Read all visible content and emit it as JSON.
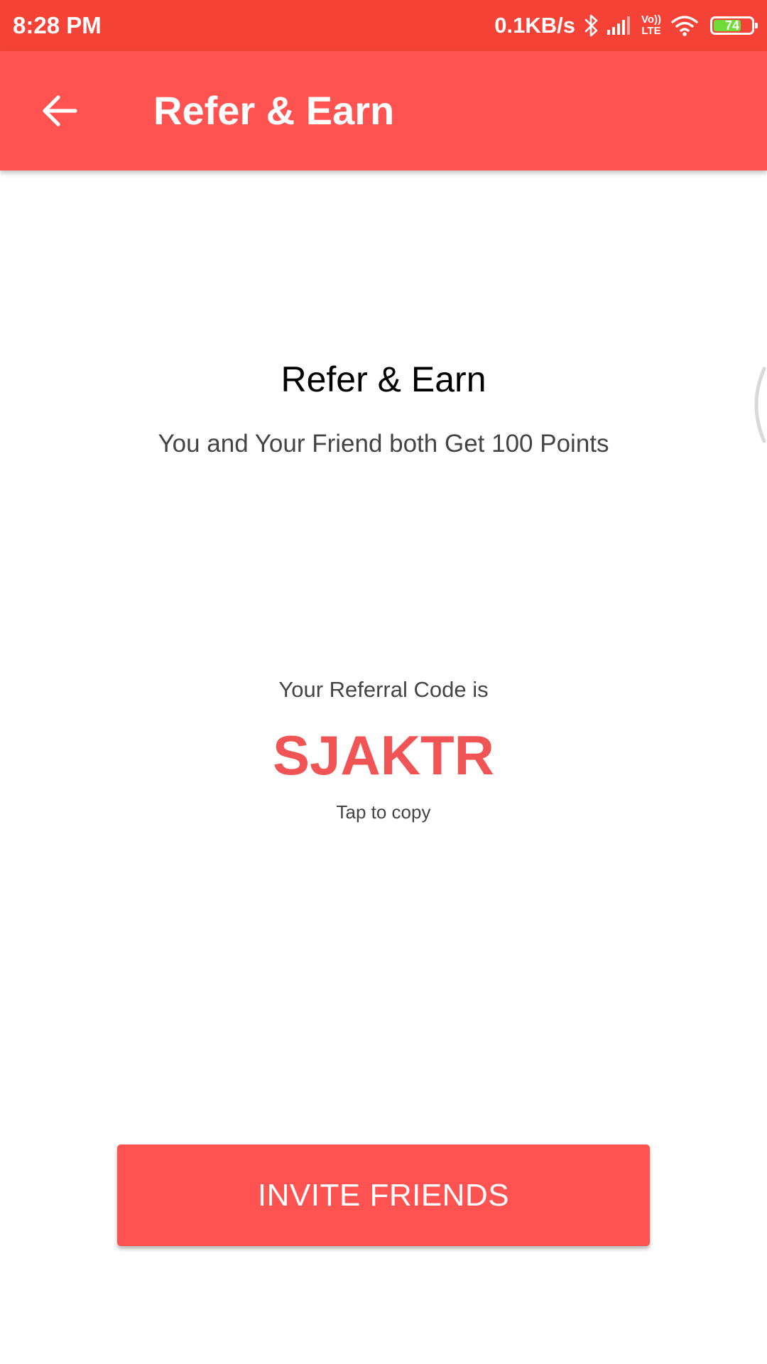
{
  "status_bar": {
    "time": "8:28 PM",
    "net_speed": "0.1KB/s",
    "volte_top": "Vo))",
    "volte_bottom": "LTE",
    "battery_level": "74",
    "battery_fill": 0.74,
    "battery_color": "#6fdc3a",
    "icons": [
      "bluetooth-icon",
      "signal-icon",
      "volte-icon",
      "wifi-icon",
      "battery-icon"
    ]
  },
  "app_bar": {
    "title": "Refer & Earn",
    "back_icon": "arrow-left-icon",
    "color": "#fe5351"
  },
  "content": {
    "title": "Refer & Earn",
    "subtitle": "You and Your Friend both Get 100 Points",
    "referral_label": "Your Referral Code is",
    "referral_code": "SJAKTR",
    "copy_hint": "Tap to copy",
    "code_color": "#f05454"
  },
  "actions": {
    "invite_label": "INVITE FRIENDS"
  },
  "colors": {
    "status_bar": "#f44336",
    "accent": "#fe5351"
  }
}
